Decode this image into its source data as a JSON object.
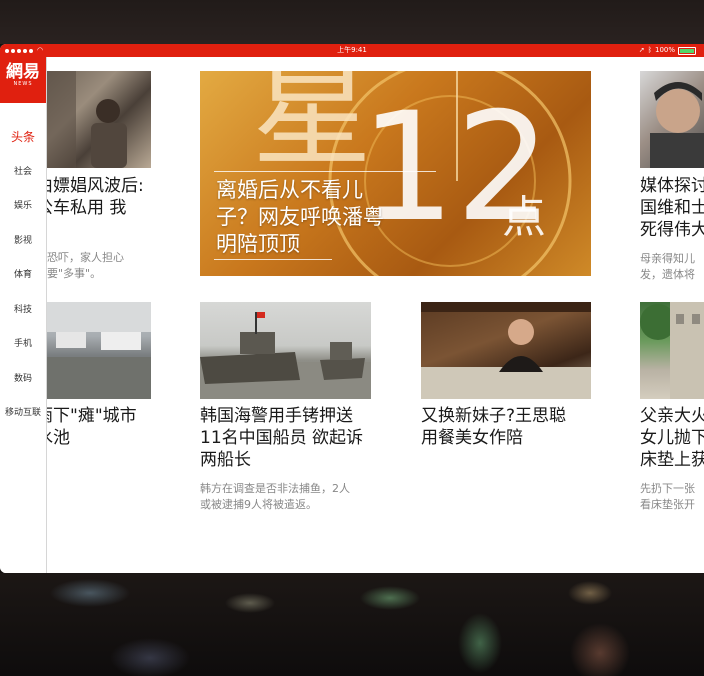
{
  "status": {
    "time": "上午9:41",
    "battery": "100%",
    "battery_level": 1.0
  },
  "sidebar": {
    "logo": "網易",
    "logo_sub": "NEWS",
    "items": [
      {
        "label": "头条",
        "active": true
      },
      {
        "label": "社会",
        "active": false
      },
      {
        "label": "娱乐",
        "active": false
      },
      {
        "label": "影视",
        "active": false
      },
      {
        "label": "体育",
        "active": false
      },
      {
        "label": "科技",
        "active": false
      },
      {
        "label": "手机",
        "active": false
      },
      {
        "label": "数码",
        "active": false
      },
      {
        "label": "移动互联",
        "active": false
      }
    ]
  },
  "hero": {
    "title": "离婚后从不看儿\n子？网友呼唤潘粤\n明陪顶顶",
    "bg_text_1": "星",
    "bg_text_2": "12",
    "bg_text_3": "点"
  },
  "articles": [
    {
      "title": "由嫖娼风波后:\n公车私用 我",
      "desc": "遭恐吓，家人担心\n不要\"多事\"。"
    },
    {
      "title": "媒体探讨\n国维和士\n死得伟大",
      "desc": "母亲得知儿\n发，遗体将"
    },
    {
      "title": "雨下\"瘫\"城市\n水池",
      "desc": ""
    },
    {
      "title": "韩国海警用手铐押送\n11名中国船员 欲起诉\n两船长",
      "desc": "韩方在调查是否非法捕鱼，2人\n或被逮捕9人将被遣返。"
    },
    {
      "title": "又换新妹子?王思聪\n用餐美女作陪",
      "desc": ""
    },
    {
      "title": "父亲大火\n女儿抛下\n床垫上获",
      "desc": "先扔下一张\n看床垫张开"
    }
  ]
}
